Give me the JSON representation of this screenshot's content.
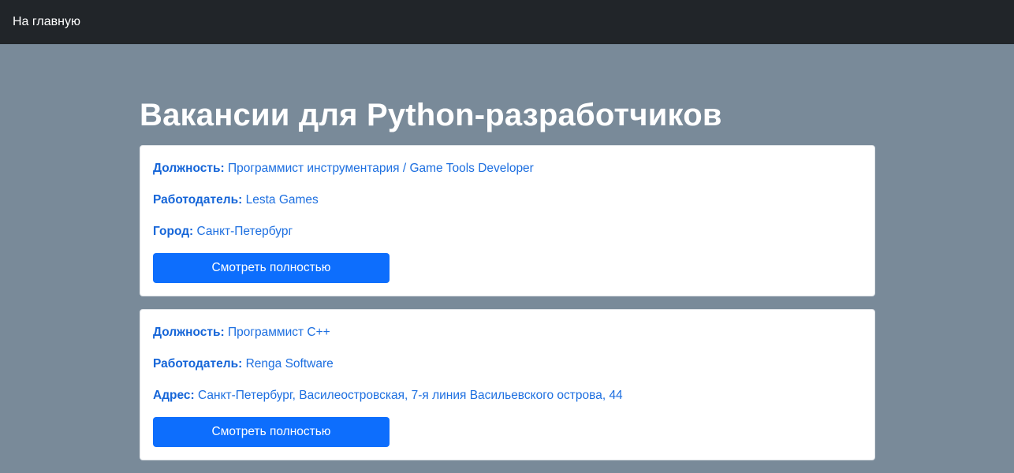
{
  "nav": {
    "home_label": "На главную"
  },
  "page": {
    "title": "Вакансии для Python-разработчиков"
  },
  "vacancies": [
    {
      "position_label": "Должность:",
      "position": "Программист инструментария / Game Tools Developer",
      "employer_label": "Работодатель:",
      "employer": "Lesta Games",
      "location_label": "Город:",
      "location": "Санкт-Петербург",
      "button_label": "Смотреть полностью"
    },
    {
      "position_label": "Должность:",
      "position": "Программист С++",
      "employer_label": "Работодатель:",
      "employer": "Renga Software",
      "location_label": "Адрес:",
      "location": "Санкт-Петербург, Василеостровская, 7-я линия Васильевского острова, 44",
      "button_label": "Смотреть полностью"
    }
  ],
  "colors": {
    "navbar": "#212529",
    "background": "#798a99",
    "link": "#1d6fe0",
    "button": "#0d6efd"
  }
}
